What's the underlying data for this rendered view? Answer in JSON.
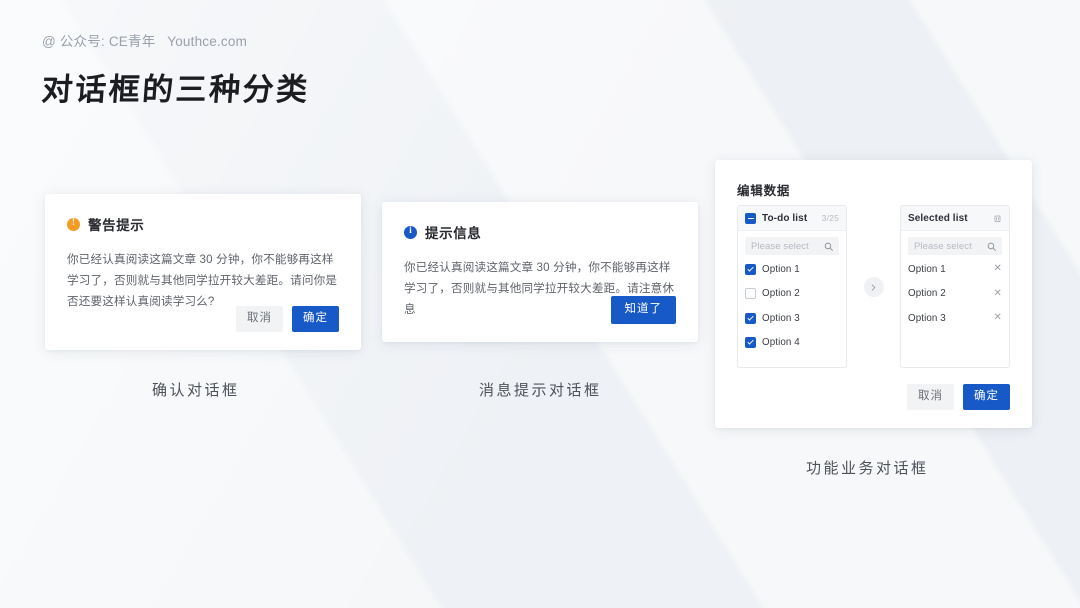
{
  "header": {
    "byline": "@ 公众号: CE青年   Youthce.com",
    "title": "对话框的三种分类"
  },
  "colors": {
    "primary": "#1859c8",
    "warning": "#f59a23",
    "info": "#1859c8",
    "card_bg": "#ffffff",
    "page_bg": "#f4f6f8",
    "default_button_bg": "#f2f3f5",
    "text_primary": "#27292e",
    "text_secondary": "#60646c",
    "placeholder": "#b6bac1"
  },
  "dialog_confirm": {
    "icon": "warning-circle-icon",
    "icon_glyph": "!",
    "title": "警告提示",
    "body": "你已经认真阅读这篇文章 30 分钟，你不能够再这样学习了，否则就与其他同学拉开较大差距。请问你是否还要这样认真阅读学习么?",
    "cancel_label": "取消",
    "confirm_label": "确定",
    "caption": "确认对话框"
  },
  "dialog_message": {
    "icon": "info-circle-icon",
    "icon_glyph": "i",
    "title": "提示信息",
    "body": "你已经认真阅读这篇文章 30 分钟，你不能够再这样学习了，否则就与其他同学拉开较大差距。请注意休息",
    "ok_label": "知道了",
    "caption": "消息提示对话框"
  },
  "dialog_transfer": {
    "title": "编辑数据",
    "caption": "功能业务对话框",
    "cancel_label": "取消",
    "confirm_label": "确定",
    "transfer_arrow_icon": "chevron-right-icon",
    "source_panel": {
      "header_label": "To-do list",
      "header_checkbox_state": "indeterminate",
      "count": "3/25",
      "search_placeholder": "Please select",
      "search_icon": "search-icon",
      "items": [
        {
          "label": "Option 1",
          "checked": true
        },
        {
          "label": "Option 2",
          "checked": false
        },
        {
          "label": "Option 3",
          "checked": true
        },
        {
          "label": "Option 4",
          "checked": true
        }
      ]
    },
    "target_panel": {
      "header_label": "Selected list",
      "header_icon": "trash-icon",
      "search_placeholder": "Please select",
      "search_icon": "search-icon",
      "items": [
        {
          "label": "Option 1",
          "remove_icon": "close-icon"
        },
        {
          "label": "Option 2",
          "remove_icon": "close-icon"
        },
        {
          "label": "Option 3",
          "remove_icon": "close-icon"
        }
      ]
    }
  }
}
